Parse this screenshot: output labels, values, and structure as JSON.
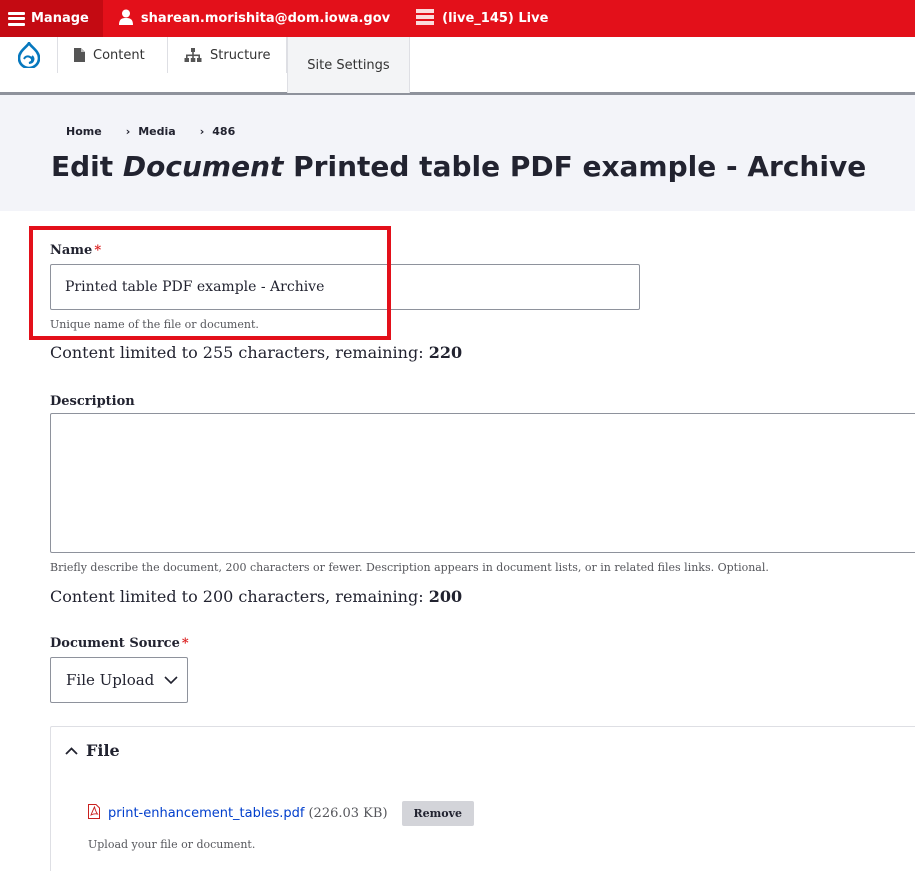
{
  "toolbar": {
    "manage_label": "Manage",
    "user_label": "sharean.morishita@dom.iowa.gov",
    "env_label": "(live_145) Live"
  },
  "tray": {
    "tabs": [
      {
        "label": "Content",
        "icon": "file-icon"
      },
      {
        "label": "Structure",
        "icon": "sitemap-icon"
      },
      {
        "label": "Site Settings"
      }
    ]
  },
  "breadcrumb": [
    "Home",
    "Media",
    "486"
  ],
  "breadcrumb_separator": "›",
  "title": {
    "prefix": "Edit ",
    "emphasis": "Document",
    "suffix": " Printed table PDF example - Archive"
  },
  "form": {
    "name": {
      "label": "Name",
      "required": "*",
      "value": "Printed table PDF example - Archive",
      "help": "Unique name of the file or document.",
      "counter_text": "Content limited to 255 characters, remaining: ",
      "counter_value": "220"
    },
    "description": {
      "label": "Description",
      "value": "",
      "help": "Briefly describe the document, 200 characters or fewer. Description appears in document lists, or in related files links. Optional.",
      "counter_text": "Content limited to 200 characters, remaining: ",
      "counter_value": "200"
    },
    "source": {
      "label": "Document Source",
      "required": "*",
      "selected": "File Upload"
    },
    "file": {
      "legend": "File",
      "filename": "print-enhancement_tables.pdf",
      "size": "(226.03 KB)",
      "remove_label": "Remove",
      "help": "Upload your file or document."
    }
  },
  "colors": {
    "toolbar_red": "#e3101a",
    "required": "#dc2323",
    "link": "#003ecc"
  }
}
